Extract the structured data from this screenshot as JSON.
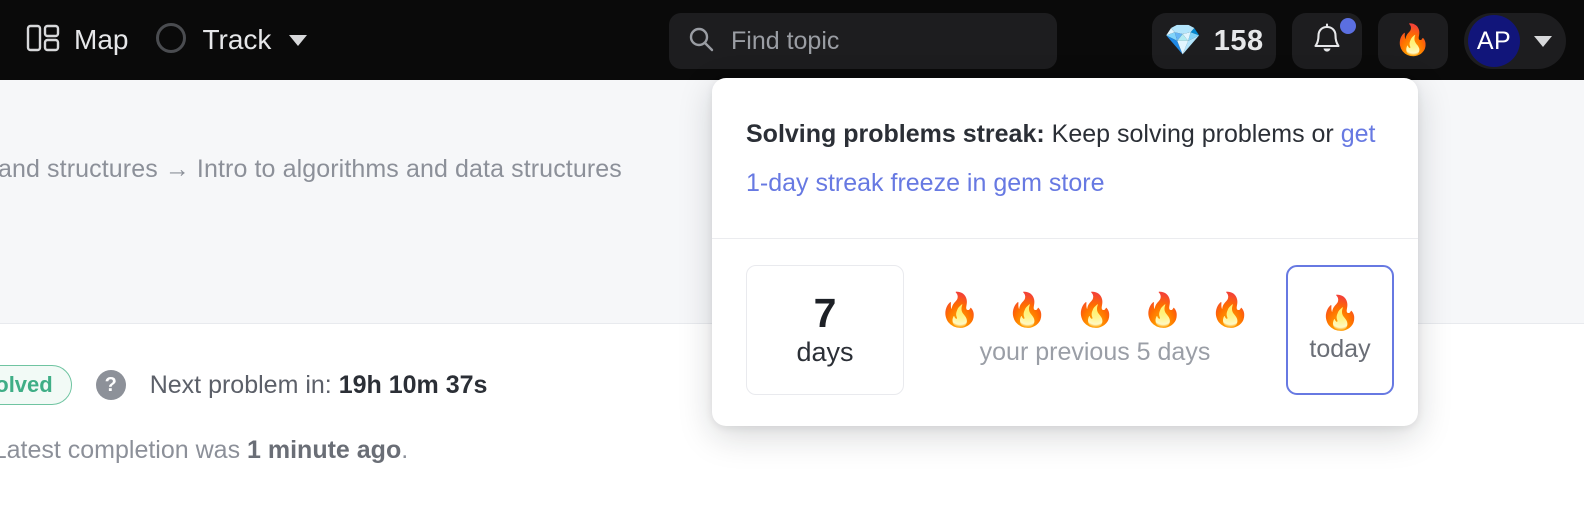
{
  "header": {
    "map": {
      "label": "Map",
      "icon": "dashboard-layout-icon"
    },
    "track": {
      "label": "Track",
      "icon": "circle-outline-icon",
      "caret": "chevron-down-icon"
    },
    "search": {
      "placeholder": "Find topic",
      "value": "",
      "icon": "search-icon"
    },
    "gems": {
      "count": "158",
      "icon": "gem-icon",
      "glyph": "💎"
    },
    "notifications": {
      "icon": "bell-icon",
      "glyph": "🔔",
      "has_unread": true,
      "dot_color": "#5b6fe0"
    },
    "streak_button": {
      "icon": "flame-icon",
      "glyph": "🔥"
    },
    "user": {
      "initials": "AP",
      "avatar_color": "#11157a",
      "caret": "chevron-down-icon"
    }
  },
  "background": {
    "breadcrumb": {
      "leading": "and structures",
      "arrow": "→",
      "trailing": "Intro to algorithms and data structures"
    },
    "status": {
      "badge": "day solved",
      "badge_color": "#3fae86",
      "help_icon": "?",
      "next_problem_prefix": "Next problem in:",
      "next_problem_time": "19h 10m 37s"
    },
    "latest": {
      "prefix": "m. Latest completion was",
      "value": "1 minute ago",
      "suffix": "."
    }
  },
  "popup": {
    "title": "Solving problems streak:",
    "body_before": " Keep solving problems or ",
    "link": "get 1-day streak freeze in gem store",
    "streak": {
      "days_number": "7",
      "days_label": "days",
      "previous_label": "your previous 5 days",
      "previous_flames": [
        "🔥",
        "🔥",
        "🔥",
        "🔥",
        "🔥"
      ],
      "today_flame": "🔥",
      "today_label": "today",
      "today_border_color": "#6779e2"
    }
  }
}
